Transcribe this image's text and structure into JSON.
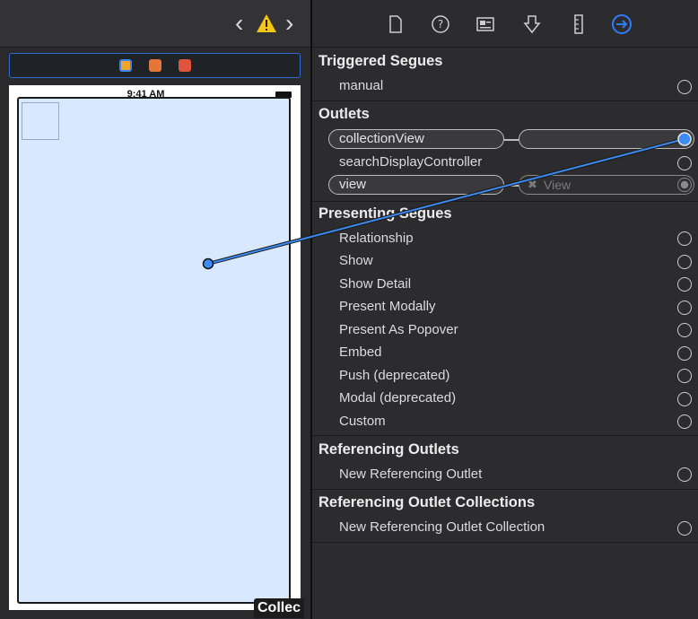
{
  "canvas": {
    "status_time": "9:41 AM",
    "bottom_label": "Collec"
  },
  "inspector": {
    "toolbar_icons": [
      "file-inspector-icon",
      "quick-help-icon",
      "identity-inspector-icon",
      "attributes-inspector-icon",
      "size-inspector-icon",
      "connections-inspector-icon"
    ],
    "sections": {
      "triggered_segues": {
        "title": "Triggered Segues",
        "items": [
          "manual"
        ]
      },
      "outlets": {
        "title": "Outlets",
        "collection_view": "collectionView",
        "search_display_controller": "searchDisplayController",
        "view": "view",
        "view_target": "View"
      },
      "presenting_segues": {
        "title": "Presenting Segues",
        "items": [
          "Relationship",
          "Show",
          "Show Detail",
          "Present Modally",
          "Present As Popover",
          "Embed",
          "Push (deprecated)",
          "Modal (deprecated)",
          "Custom"
        ]
      },
      "referencing_outlets": {
        "title": "Referencing Outlets",
        "items": [
          "New Referencing Outlet"
        ]
      },
      "referencing_outlet_collections": {
        "title": "Referencing Outlet Collections",
        "items": [
          "New Referencing Outlet Collection"
        ]
      }
    }
  },
  "colors": {
    "accent": "#2f7cf6",
    "warning": "#f5c518",
    "canvas_fill": "#d8e8ff"
  }
}
